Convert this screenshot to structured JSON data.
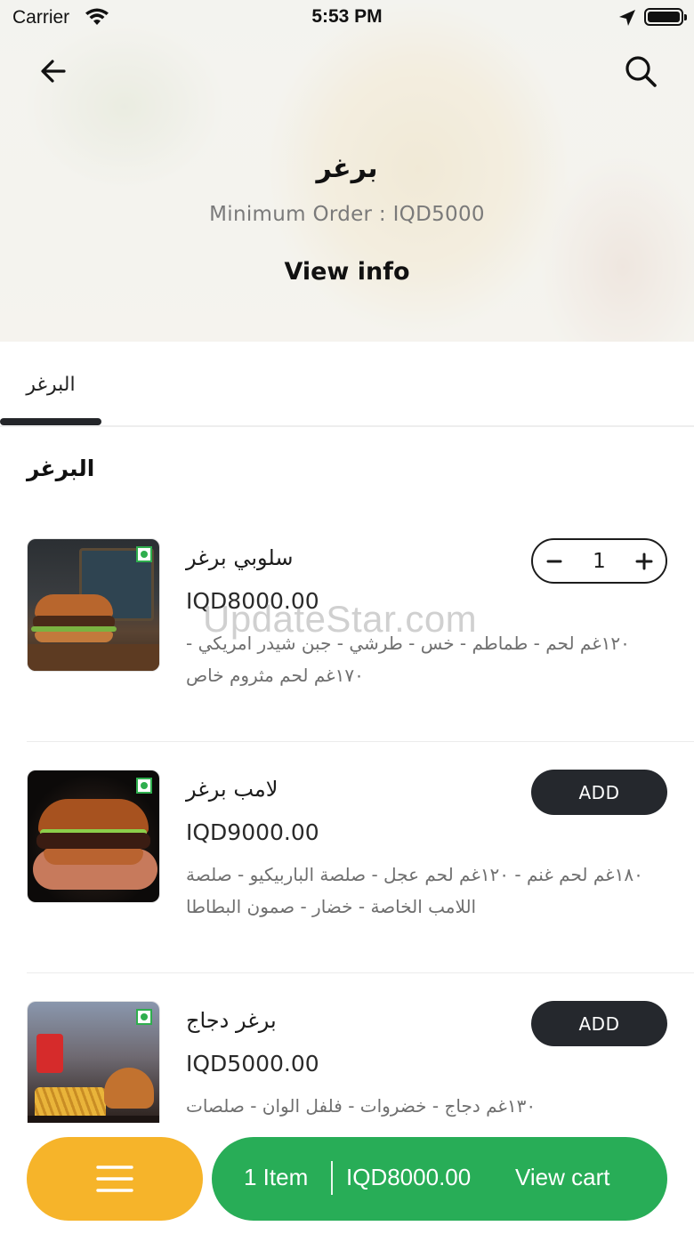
{
  "status_bar": {
    "carrier": "Carrier",
    "time": "5:53 PM"
  },
  "header": {
    "title": "برغر",
    "minimum_order": "Minimum Order : IQD5000",
    "view_info": "View info",
    "back_icon": "arrow-left-icon",
    "search_icon": "search-icon"
  },
  "tabs": [
    {
      "label": "البرغر",
      "active": true
    }
  ],
  "section": {
    "title": "البرغر"
  },
  "items": [
    {
      "name": "سلوبي برغر",
      "price": "IQD8000.00",
      "description": "١٢٠غم لحم - طماطم - خس - طرشي - جبن شيدر امريكي - ١٧٠غم لحم مثروم خاص",
      "action": "stepper",
      "quantity": "1",
      "veg_icon": "veg-indicator-icon"
    },
    {
      "name": "لامب برغر",
      "price": "IQD9000.00",
      "description": "١٨٠غم لحم غنم - ١٢٠غم لحم عجل - صلصة الباربيكيو - صلصة اللامب الخاصة - خضار - صمون البطاطا",
      "action": "add",
      "add_label": "ADD",
      "veg_icon": "veg-indicator-icon"
    },
    {
      "name": "برغر دجاج",
      "price": "IQD5000.00",
      "description": "١٣٠غم دجاج - خضروات - فلفل الوان - صلصات",
      "action": "add",
      "add_label": "ADD",
      "veg_icon": "veg-indicator-icon"
    }
  ],
  "watermark": "UpdateStar.com",
  "bottom_bar": {
    "menu_icon": "hamburger-menu-icon",
    "cart_count": "1 Item",
    "cart_total": "IQD8000.00",
    "cart_action": "View cart"
  },
  "colors": {
    "cart_green": "#28ad57",
    "menu_orange": "#f6b42a",
    "dark_button": "#25282d",
    "veg_green": "#2fae4e"
  }
}
